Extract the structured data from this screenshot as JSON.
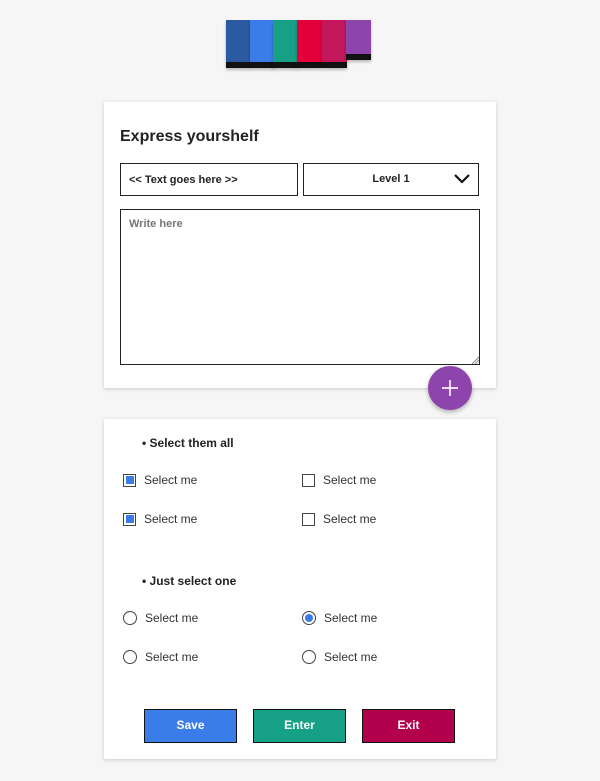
{
  "logo": {
    "bars": [
      "#2c5aa0",
      "#3a7de8",
      "#16a085",
      "#e3003a",
      "#c2185b",
      "#8e44ad"
    ]
  },
  "form": {
    "title": "Express yourshelf",
    "text_input": {
      "value": "<< Text goes here >>"
    },
    "level_select": {
      "value": "Level 1"
    },
    "textarea": {
      "placeholder": "Write here"
    }
  },
  "checkbox_group": {
    "label": "Select them all",
    "options": [
      {
        "label": "Select me",
        "checked": true
      },
      {
        "label": "Select me",
        "checked": false
      },
      {
        "label": "Select me",
        "checked": true
      },
      {
        "label": "Select me",
        "checked": false
      }
    ]
  },
  "radio_group": {
    "label": "Just select one",
    "options": [
      {
        "label": "Select me",
        "checked": false
      },
      {
        "label": "Select me",
        "checked": true
      },
      {
        "label": "Select me",
        "checked": false
      },
      {
        "label": "Select me",
        "checked": false
      }
    ]
  },
  "buttons": {
    "save": {
      "label": "Save",
      "color": "#3a7de8"
    },
    "enter": {
      "label": "Enter",
      "color": "#16a085"
    },
    "exit": {
      "label": "Exit",
      "color": "#b3004d"
    }
  },
  "colors": {
    "accent": "#3a7de8",
    "fab": "#8e44ad"
  },
  "icons": {
    "fab": "plus-icon",
    "select": "chevron-down-icon"
  }
}
